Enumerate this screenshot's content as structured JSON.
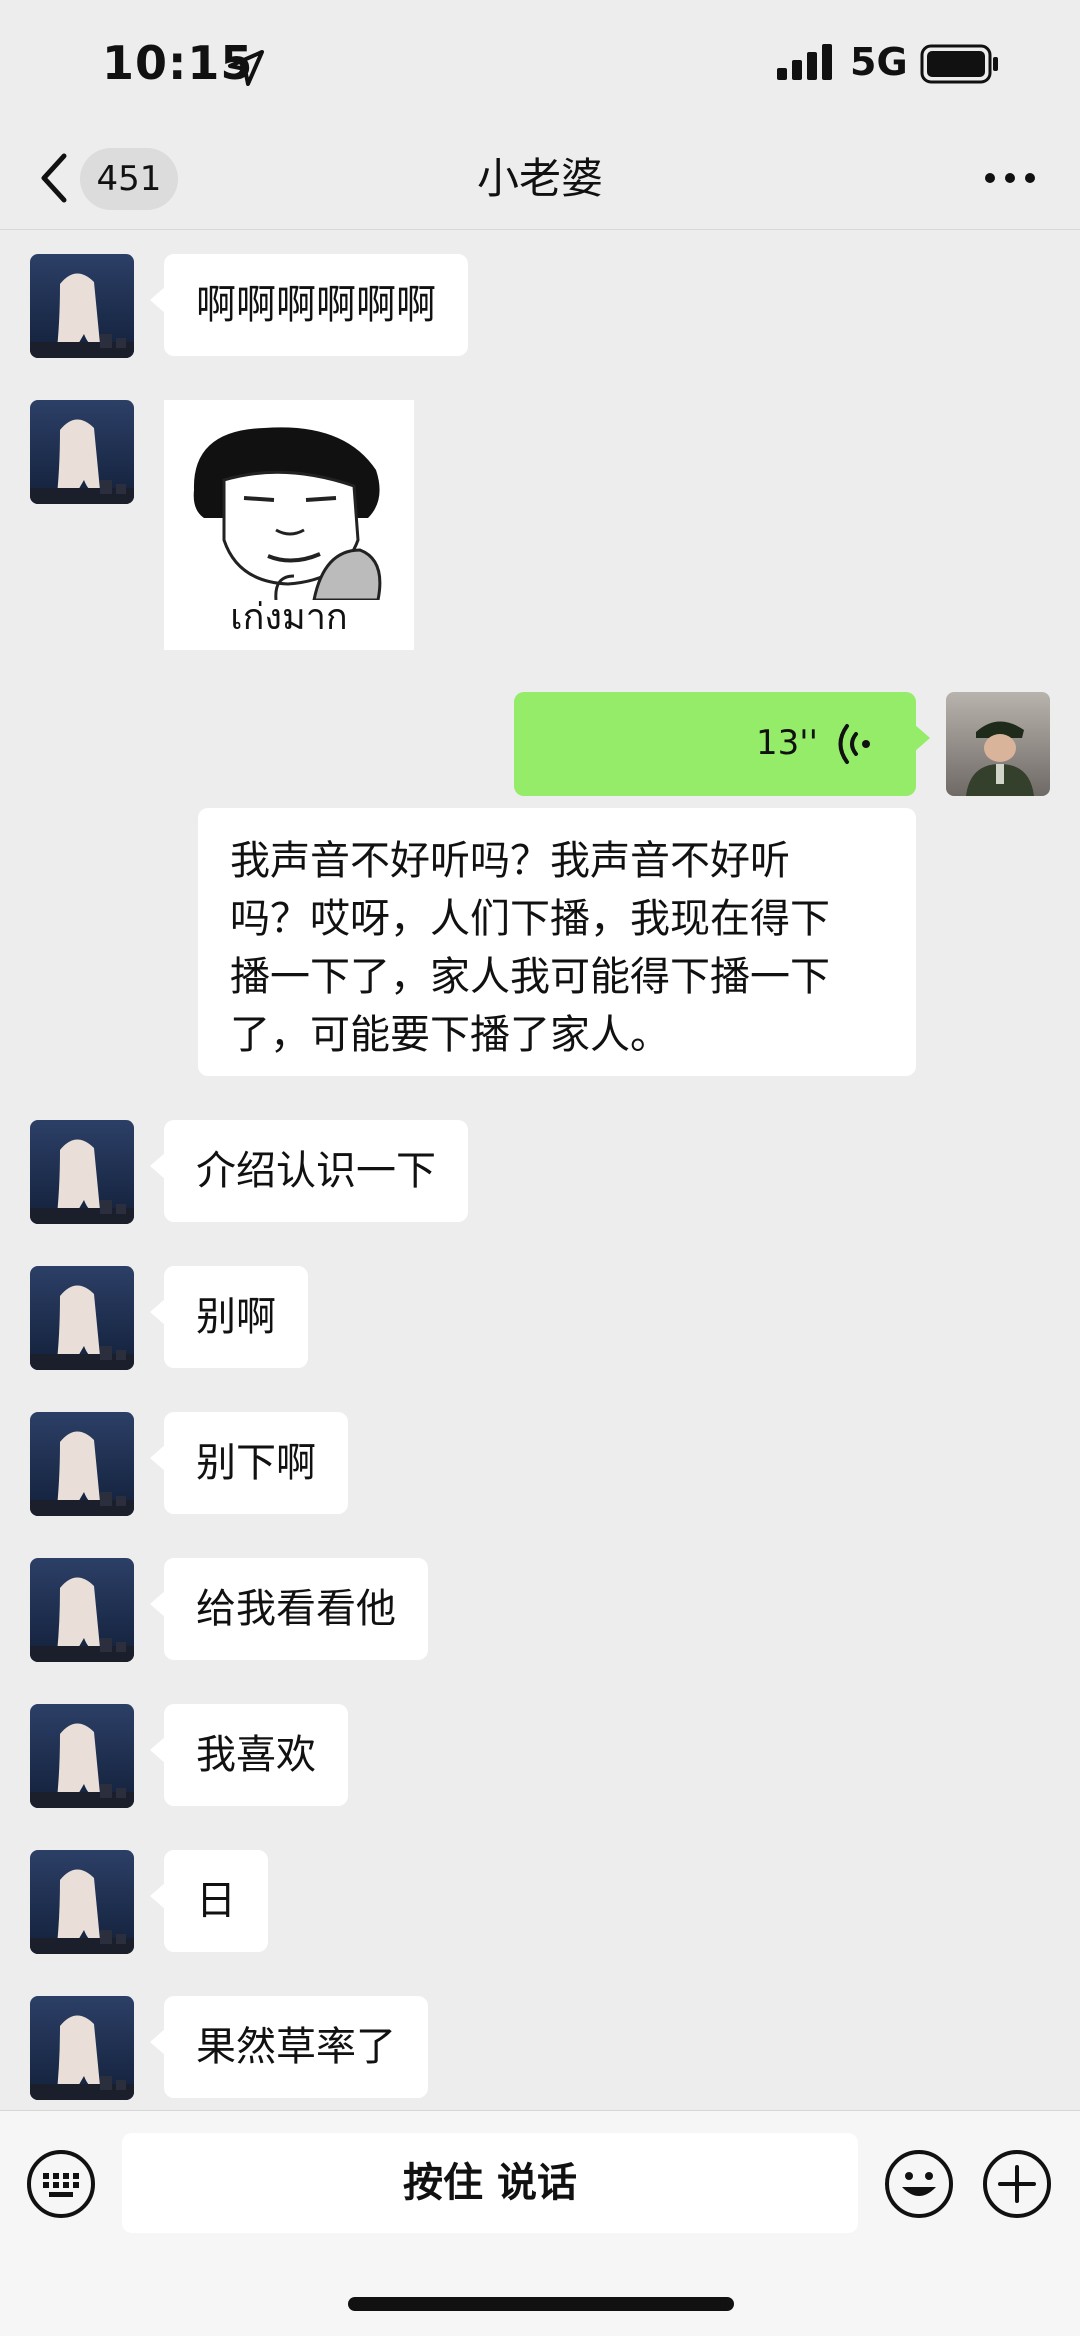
{
  "status_bar": {
    "time": "10:15",
    "network": "5G"
  },
  "nav": {
    "unread_count": "451",
    "title": "小老婆"
  },
  "messages": [
    {
      "type": "text",
      "text": "啊啊啊啊啊啊"
    },
    {
      "type": "sticker",
      "caption": "เก่งมาก"
    },
    {
      "type": "voice",
      "duration": "13''"
    },
    {
      "type": "transcript",
      "lines": [
        "我声音不好听吗？我声音不好听",
        "吗？哎呀，人们下播，我现在得下",
        "播一下了，家人我可能得下播一下",
        "了，可能要下播了家人。"
      ]
    },
    {
      "type": "text",
      "text": "介绍认识一下"
    },
    {
      "type": "text",
      "text": "别啊"
    },
    {
      "type": "text",
      "text": "别下啊"
    },
    {
      "type": "text",
      "text": "给我看看他"
    },
    {
      "type": "text",
      "text": "我喜欢"
    },
    {
      "type": "text",
      "text": "日"
    },
    {
      "type": "text",
      "text": "果然草率了"
    }
  ],
  "bottom_bar": {
    "hold_to_talk": "按住 说话"
  },
  "colors": {
    "background": "#ededed",
    "sent_bubble": "#95ec69",
    "received_bubble": "#ffffff"
  },
  "icons": [
    "location-arrow-icon",
    "signal-icon",
    "battery-icon",
    "back-chevron-icon",
    "more-dots-icon",
    "voice-wave-icon",
    "keyboard-icon",
    "emoji-icon",
    "plus-icon"
  ]
}
